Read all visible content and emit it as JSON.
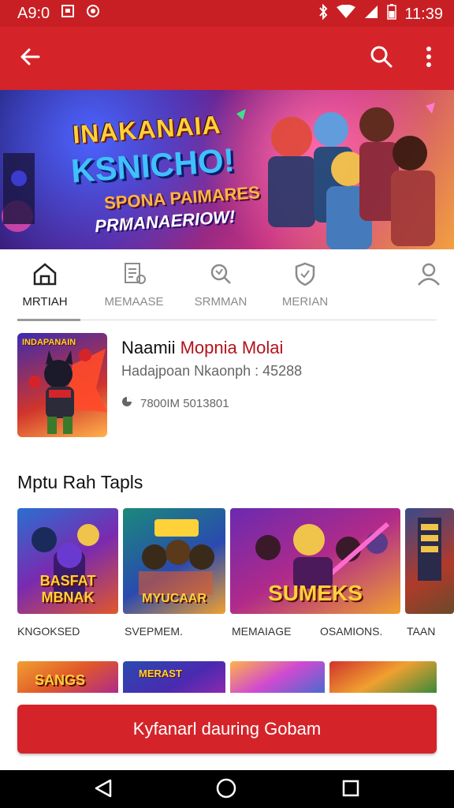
{
  "status_bar": {
    "time_left": "A9:0",
    "time_right": "11:39"
  },
  "icons": {
    "back": "arrow-left-icon",
    "search": "search-icon",
    "more": "more-vert-icon",
    "bluetooth": "bluetooth-icon",
    "wifi": "wifi-icon",
    "signal": "signal-icon",
    "battery": "battery-icon"
  },
  "banner": {
    "line1": "INAKANAIA",
    "line2": "KSNICHO!",
    "line3": "SPONA PAIMARES",
    "line4": "PRMANAERIOW!"
  },
  "tabs": [
    {
      "label": "MRTIAH",
      "icon": "house-icon",
      "active": true
    },
    {
      "label": "MEMAASE",
      "icon": "document-icon",
      "active": false
    },
    {
      "label": "SRMMAN",
      "icon": "magnifier-icon",
      "active": false
    },
    {
      "label": "MERIAN",
      "icon": "shield-icon",
      "active": false
    },
    {
      "label": "",
      "icon": "profile-icon",
      "active": false
    }
  ],
  "featured": {
    "thumb_text": "INDAPANAIN",
    "title_black": "Naamii ",
    "title_red": "Mopnia Molai",
    "meta": "Hadajpoan Nkaonph : 45288",
    "info": "7800IM 5013801"
  },
  "section": {
    "title": "Mptu Rah Tapls"
  },
  "cards": [
    {
      "label": "KNGOKSED",
      "art": "BASFAT MBNAK"
    },
    {
      "label": "SVEPMEM.",
      "art": "MYUCAAR"
    },
    {
      "label": "MEMAIAGE",
      "art": "SUMEKS"
    },
    {
      "label": "OSAMIONS.",
      "art": ""
    },
    {
      "label": "TAAN",
      "art": ""
    }
  ],
  "cards_row2": [
    {
      "art": "SANGS"
    },
    {
      "art": "MERAST"
    },
    {
      "art": ""
    },
    {
      "art": ""
    }
  ],
  "cta": {
    "label": "Kyfanarl dauring Gobam"
  },
  "colors": {
    "primary": "#d4242a",
    "status_bar": "#c81f24",
    "accent_red": "#b3121b"
  }
}
